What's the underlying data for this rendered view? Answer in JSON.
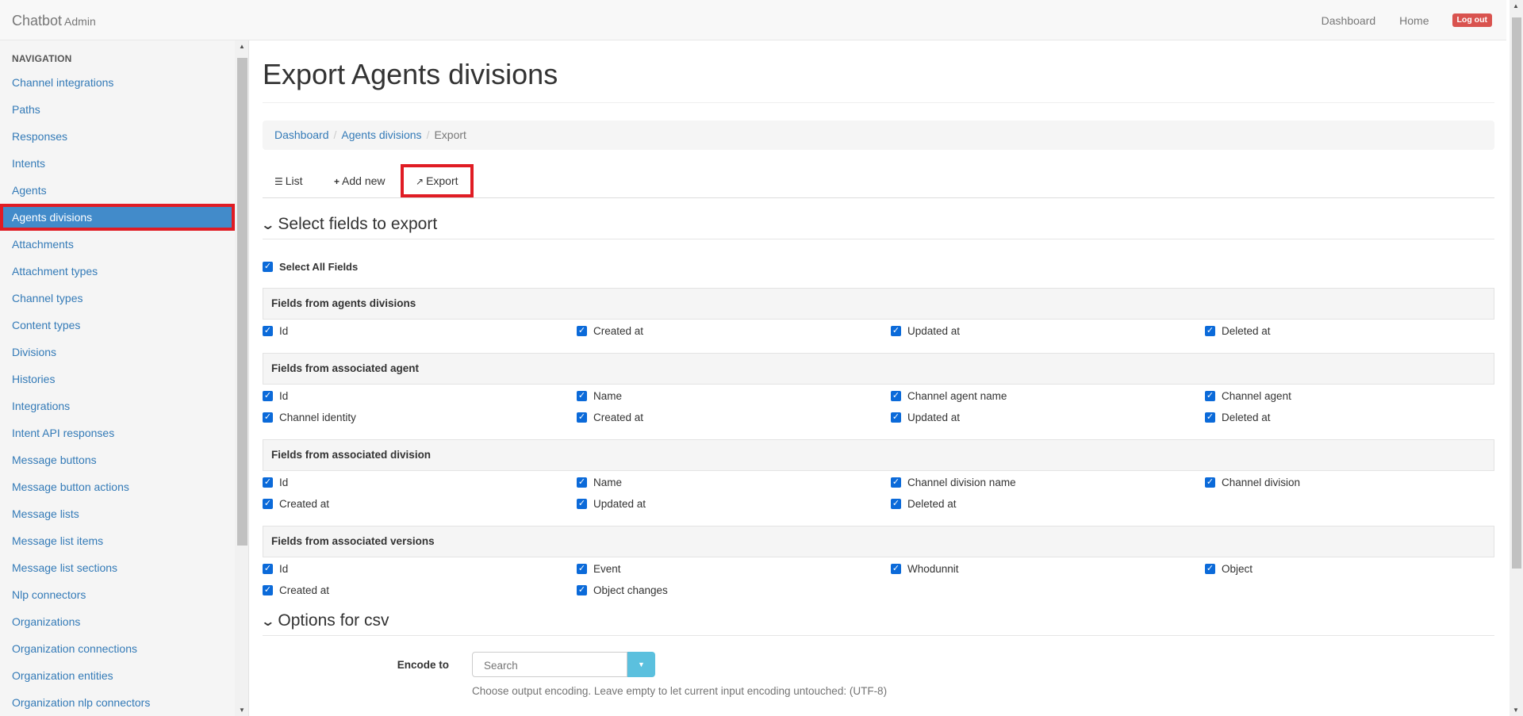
{
  "navbar": {
    "brand": "Chatbot",
    "brand_sub": "Admin",
    "links": [
      "Dashboard",
      "Home"
    ],
    "logout": "Log out"
  },
  "sidebar": {
    "header": "NAVIGATION",
    "items": [
      {
        "label": "Channel integrations"
      },
      {
        "label": "Paths"
      },
      {
        "label": "Responses"
      },
      {
        "label": "Intents"
      },
      {
        "label": "Agents"
      },
      {
        "label": "Agents divisions",
        "active": true
      },
      {
        "label": "Attachments"
      },
      {
        "label": "Attachment types"
      },
      {
        "label": "Channel types"
      },
      {
        "label": "Content types"
      },
      {
        "label": "Divisions"
      },
      {
        "label": "Histories"
      },
      {
        "label": "Integrations"
      },
      {
        "label": "Intent API responses"
      },
      {
        "label": "Message buttons"
      },
      {
        "label": "Message button actions"
      },
      {
        "label": "Message lists"
      },
      {
        "label": "Message list items"
      },
      {
        "label": "Message list sections"
      },
      {
        "label": "Nlp connectors"
      },
      {
        "label": "Organizations"
      },
      {
        "label": "Organization connections"
      },
      {
        "label": "Organization entities"
      },
      {
        "label": "Organization nlp connectors"
      }
    ]
  },
  "page": {
    "title": "Export Agents divisions",
    "breadcrumb": {
      "home": "Dashboard",
      "section": "Agents divisions",
      "current": "Export"
    },
    "tabs": {
      "list": "List",
      "add_new": "Add new",
      "export": "Export"
    },
    "select_section": "Select fields to export",
    "select_all": "Select All Fields",
    "groups": [
      {
        "title": "Fields from agents divisions",
        "rows": [
          [
            "Id",
            "Created at",
            "Updated at",
            "Deleted at"
          ]
        ]
      },
      {
        "title": "Fields from associated agent",
        "rows": [
          [
            "Id",
            "Name",
            "Channel agent name",
            "Channel agent"
          ],
          [
            "Channel identity",
            "Created at",
            "Updated at",
            "Deleted at"
          ]
        ]
      },
      {
        "title": "Fields from associated division",
        "rows": [
          [
            "Id",
            "Name",
            "Channel division name",
            "Channel division"
          ],
          [
            "Created at",
            "Updated at",
            "Deleted at"
          ]
        ]
      },
      {
        "title": "Fields from associated versions",
        "rows": [
          [
            "Id",
            "Event",
            "Whodunnit",
            "Object"
          ],
          [
            "Created at",
            "Object changes"
          ]
        ]
      }
    ],
    "options_section": "Options for csv",
    "encode": {
      "label": "Encode to",
      "placeholder": "Search",
      "help": "Choose output encoding. Leave empty to let current input encoding untouched: (UTF-8)"
    }
  },
  "colors": {
    "accent": "#428bca",
    "highlight": "#e01c24",
    "link": "#337ab7",
    "danger": "#d9534f",
    "checkbox": "#0b6ad9"
  }
}
